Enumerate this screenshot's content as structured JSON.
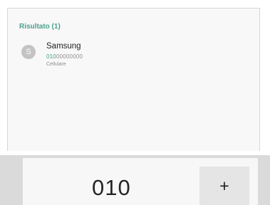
{
  "results": {
    "header": "Risultato (1)",
    "contact": {
      "avatar_letter": "S",
      "name": "Samsung",
      "number_highlight": "010",
      "number_rest": "00000000",
      "type": "Cellulare"
    }
  },
  "dialer": {
    "number": "010",
    "add_button_label": "+"
  }
}
